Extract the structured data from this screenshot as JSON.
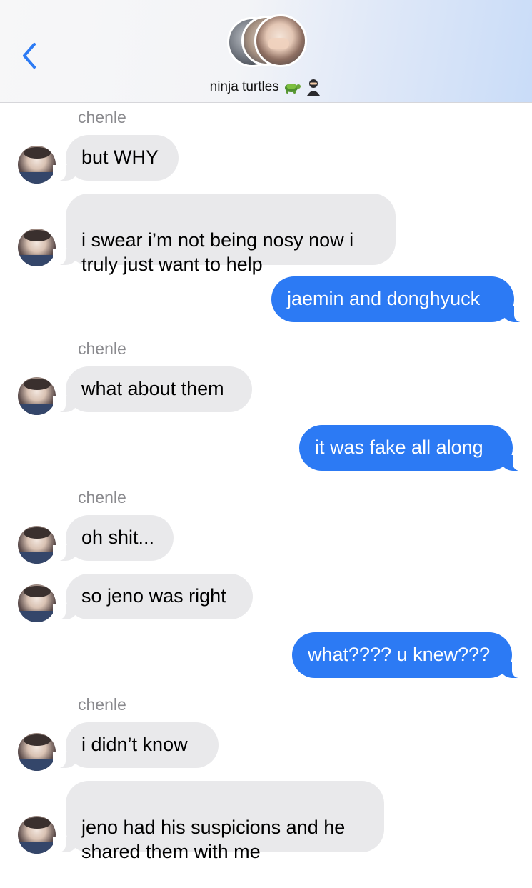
{
  "header": {
    "chat_name": "ninja turtles",
    "emojis": [
      "turtle-emoji",
      "ninja-emoji"
    ]
  },
  "colors": {
    "incoming_bubble": "#e9e9eb",
    "outgoing_bubble": "#2c7af4",
    "sender_label": "#8a8a8e",
    "back_chevron": "#2c7af4"
  },
  "messages": [
    {
      "direction": "in",
      "sender": "chenle",
      "text": "but WHY"
    },
    {
      "direction": "in",
      "text": "i swear i’m not being nosy now i\ntruly just want to help"
    },
    {
      "direction": "out",
      "text": "jaemin and donghyuck"
    },
    {
      "direction": "in",
      "sender": "chenle",
      "text": "what about them"
    },
    {
      "direction": "out",
      "text": "it was fake all along"
    },
    {
      "direction": "in",
      "sender": "chenle",
      "text": "oh shit..."
    },
    {
      "direction": "in",
      "text": "so jeno was right"
    },
    {
      "direction": "out",
      "text": "what???? u knew???"
    },
    {
      "direction": "in",
      "sender": "chenle",
      "text": "i didn’t know"
    },
    {
      "direction": "in",
      "text": "jeno had his suspicions and he\nshared them with me"
    }
  ]
}
